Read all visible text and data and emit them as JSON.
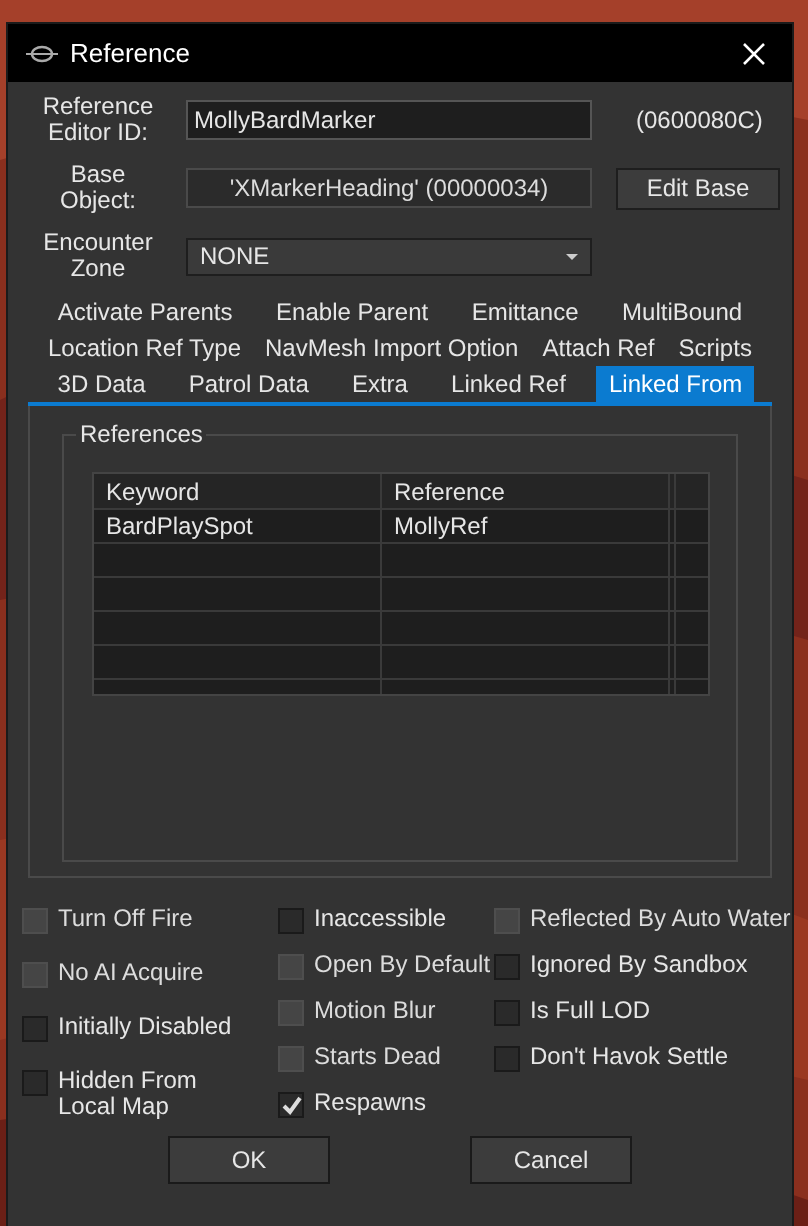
{
  "window": {
    "title": "Reference"
  },
  "editor_id": {
    "label": "Reference Editor ID:",
    "value": "MollyBardMarker",
    "form_id": "(0600080C)"
  },
  "base_object": {
    "label": "Base Object:",
    "value": "'XMarkerHeading' (00000034)",
    "button": "Edit Base"
  },
  "encounter_zone": {
    "label": "Encounter Zone",
    "value": "NONE"
  },
  "tab_rows": [
    [
      {
        "label": "Activate Parents",
        "selected": false
      },
      {
        "label": "Enable Parent",
        "selected": false
      },
      {
        "label": "Emittance",
        "selected": false
      },
      {
        "label": "MultiBound",
        "selected": false
      }
    ],
    [
      {
        "label": "Location Ref Type",
        "selected": false
      },
      {
        "label": "NavMesh Import Option",
        "selected": false
      },
      {
        "label": "Attach Ref",
        "selected": false
      },
      {
        "label": "Scripts",
        "selected": false
      }
    ],
    [
      {
        "label": "3D Data",
        "selected": false
      },
      {
        "label": "Patrol Data",
        "selected": false
      },
      {
        "label": "Extra",
        "selected": false
      },
      {
        "label": "Linked Ref",
        "selected": false
      },
      {
        "label": "Linked From",
        "selected": true
      }
    ]
  ],
  "references": {
    "title": "References",
    "columns": [
      "Keyword",
      "Reference"
    ],
    "rows": [
      [
        "BardPlaySpot",
        "MollyRef"
      ]
    ]
  },
  "flag_columns": [
    [
      {
        "label": "Turn Off Fire",
        "checked": false,
        "disabled": true
      },
      {
        "label": "No AI Acquire",
        "checked": false,
        "disabled": true
      },
      {
        "label": "Initially Disabled",
        "checked": false,
        "disabled": false
      },
      {
        "label": "Hidden From Local Map",
        "checked": false,
        "disabled": false
      }
    ],
    [
      {
        "label": "Inaccessible",
        "checked": false,
        "disabled": false
      },
      {
        "label": "Open By Default",
        "checked": false,
        "disabled": true
      },
      {
        "label": "Motion Blur",
        "checked": false,
        "disabled": true
      },
      {
        "label": "Starts Dead",
        "checked": false,
        "disabled": true
      },
      {
        "label": "Respawns",
        "checked": true,
        "disabled": false
      }
    ],
    [
      {
        "label": "Reflected By Auto Water",
        "checked": false,
        "disabled": true
      },
      {
        "label": "Ignored By Sandbox",
        "checked": false,
        "disabled": false
      },
      {
        "label": "Is Full LOD",
        "checked": false,
        "disabled": false
      },
      {
        "label": "Don't Havok Settle",
        "checked": false,
        "disabled": false
      }
    ]
  ],
  "buttons": [
    "OK",
    "Cancel"
  ]
}
